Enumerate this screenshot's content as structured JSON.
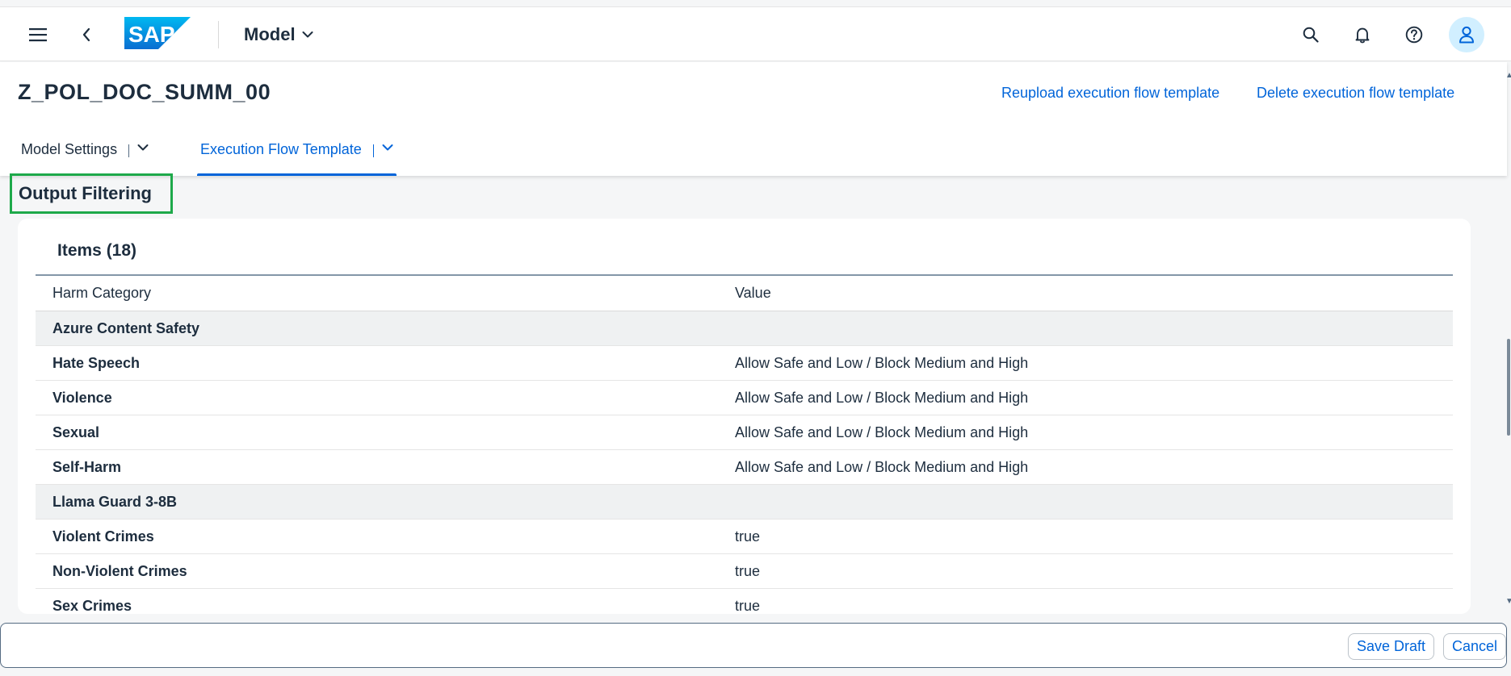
{
  "shellbar": {
    "title": "Model",
    "logo_text": "SAP"
  },
  "header": {
    "object_title": "Z_POL_DOC_SUMM_00",
    "actions": {
      "reupload": "Reupload execution flow template",
      "delete": "Delete execution flow template"
    },
    "tabs": [
      {
        "label": "Model Settings"
      },
      {
        "label": "Execution Flow Template"
      }
    ]
  },
  "section": {
    "title": "Output Filtering"
  },
  "table": {
    "title": "Items (18)",
    "columns": [
      "Harm Category",
      "Value"
    ],
    "rows": [
      {
        "category": "Azure Content Safety",
        "value": ""
      },
      {
        "category": "Hate Speech",
        "value": "Allow Safe and Low / Block Medium and High"
      },
      {
        "category": "Violence",
        "value": "Allow Safe and Low / Block Medium and High"
      },
      {
        "category": "Sexual",
        "value": "Allow Safe and Low / Block Medium and High"
      },
      {
        "category": "Self-Harm",
        "value": "Allow Safe and Low / Block Medium and High"
      },
      {
        "category": "Llama Guard 3-8B",
        "value": ""
      },
      {
        "category": "Violent Crimes",
        "value": "true"
      },
      {
        "category": "Non-Violent Crimes",
        "value": "true"
      },
      {
        "category": "Sex Crimes",
        "value": "true"
      }
    ]
  },
  "footer": {
    "save_draft": "Save Draft",
    "cancel": "Cancel"
  },
  "colors": {
    "accent": "#0064d9",
    "highlight_border": "#1ea94a",
    "avatar_bg": "#d1efff"
  }
}
